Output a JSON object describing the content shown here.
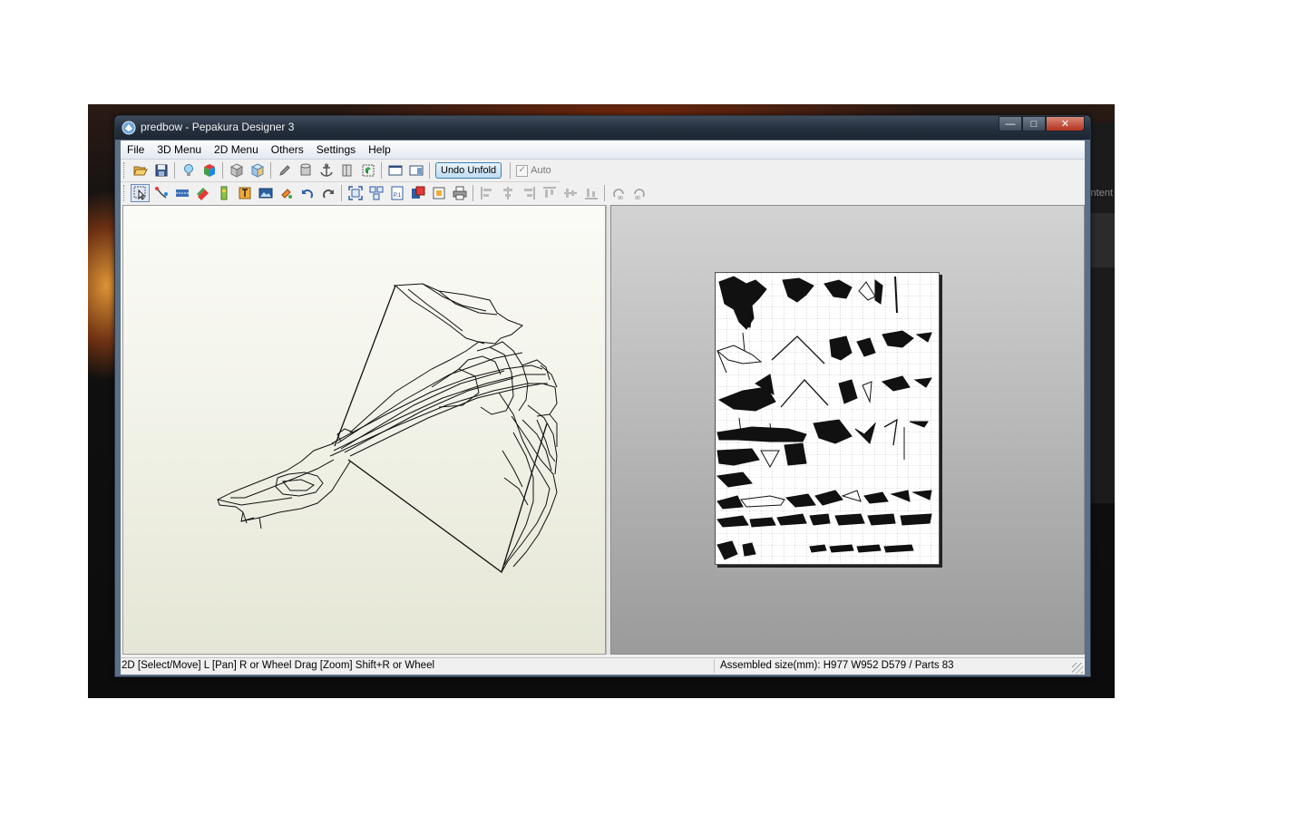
{
  "window": {
    "title": "predbow - Pepakura Designer 3"
  },
  "background": {
    "side_text": "ntent"
  },
  "menubar": {
    "items": [
      "File",
      "3D Menu",
      "2D Menu",
      "Others",
      "Settings",
      "Help"
    ]
  },
  "toolbar1": {
    "undo_unfold_label": "Undo Unfold",
    "auto_label": "Auto",
    "auto_checked": true
  },
  "toolbar2": {
    "print_page_badge": "P.1",
    "rotate_left_badge": "90",
    "rotate_right_badge": "90"
  },
  "statusbar": {
    "left": "2D [Select/Move] L [Pan] R or Wheel Drag [Zoom] Shift+R or Wheel",
    "right": "Assembled size(mm): H977 W952 D579 / Parts 83"
  },
  "colors": {
    "titlebar": "#263140",
    "close_button": "#c0442c",
    "pane_3d_bg": "#f1f2e7",
    "pane_2d_bg": "#bdbdbd",
    "undo_button": "#bfdcf2"
  },
  "icons": {
    "toolbar1": [
      "open-folder-icon",
      "save-icon",
      "lightbulb-icon",
      "colored-cube-icon",
      "cube-icon",
      "texture-cube-icon",
      "pencil-icon",
      "cylinder-icon",
      "anchor-icon",
      "split-icon",
      "unfold-icon",
      "single-pane-icon",
      "two-pane-icon"
    ],
    "toolbar2": [
      "select-icon",
      "join-edge-icon",
      "fold-line-icon",
      "layers-icon",
      "flap-icon",
      "text-icon",
      "image-icon",
      "paint-icon",
      "undo-icon",
      "redo-icon",
      "zoom-fit-icon",
      "arrange-icon",
      "print-page-icon",
      "page-layout-icon",
      "page-setup-icon",
      "print-icon",
      "align-left-icon",
      "align-center-icon",
      "align-right-icon",
      "align-top-icon",
      "align-middle-icon",
      "align-bottom-icon",
      "rotate-left-90-icon",
      "rotate-right-90-icon"
    ]
  }
}
